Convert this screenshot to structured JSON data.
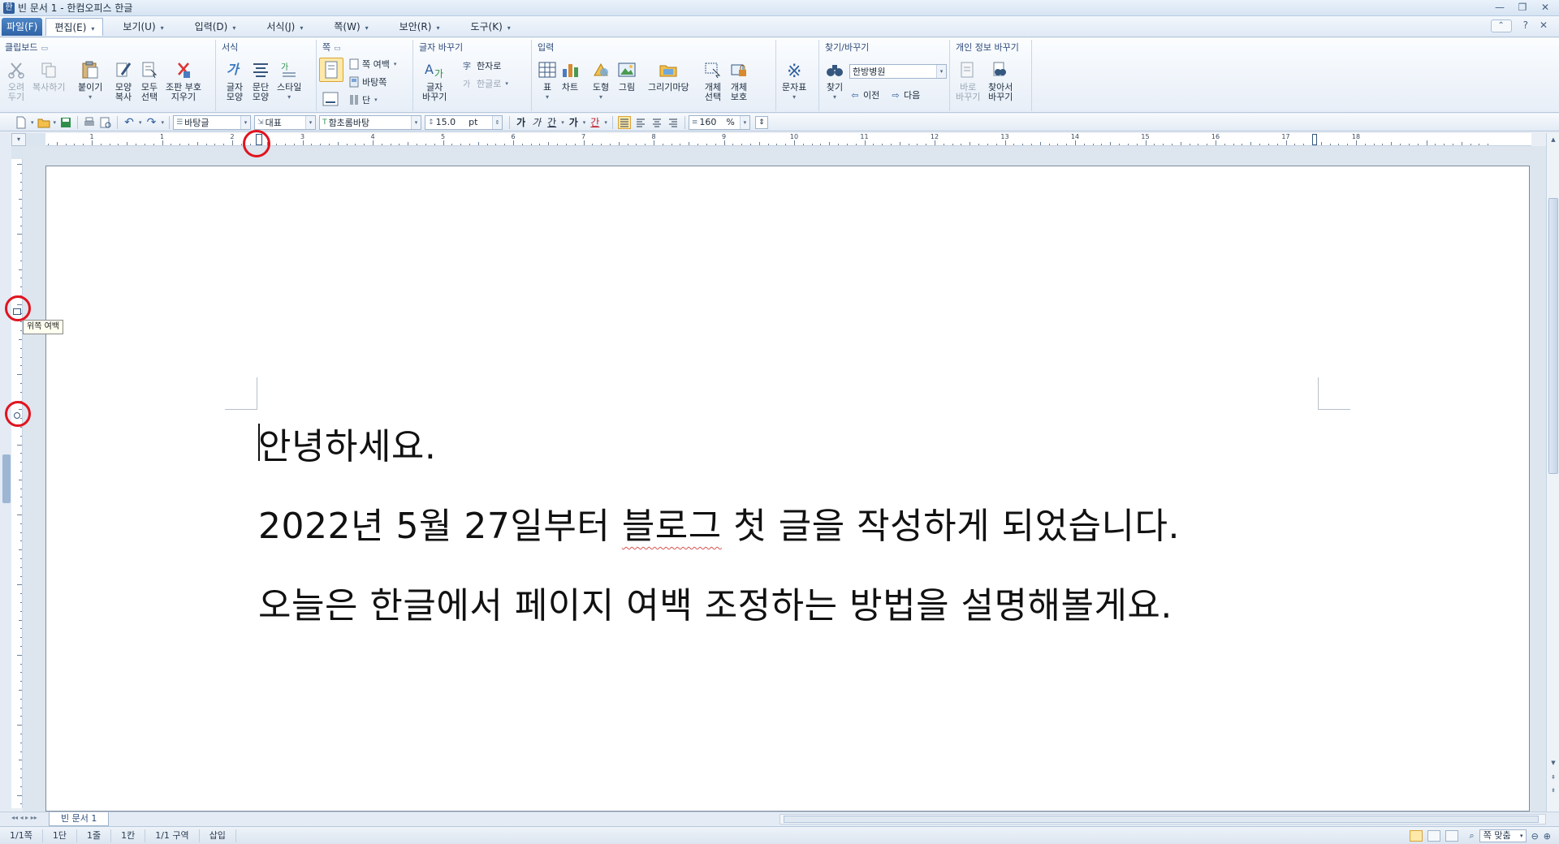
{
  "window": {
    "title": "빈 문서 1 - 한컴오피스 한글",
    "icon_label": "한",
    "minimize_icon": "minimize-icon",
    "restore_icon": "restore-icon",
    "close_icon": "close-icon"
  },
  "menubar": {
    "file": "파일(F)",
    "edit": "편집(E)",
    "view": "보기(U)",
    "insert": "입력(D)",
    "format": "서식(J)",
    "page": "쪽(W)",
    "security": "보안(R)",
    "tools": "도구(K)",
    "help": "?"
  },
  "ribbon": {
    "clipboard": {
      "label": "클립보드",
      "cut": [
        "오려",
        "두기"
      ],
      "copy": "복사하기",
      "paste": "붙이기",
      "format_painter": [
        "모양",
        "복사"
      ],
      "select_all": [
        "모두",
        "선택"
      ],
      "clear_marks": [
        "조판 부호",
        "지우기"
      ]
    },
    "format": {
      "label": "서식",
      "char_shape": [
        "글자",
        "모양"
      ],
      "para_shape": [
        "문단",
        "모양"
      ],
      "style": "스타일"
    },
    "page": {
      "label": "쪽",
      "margin": "쪽 여백",
      "background": "바탕쪽",
      "columns": "단"
    },
    "change_char": {
      "label": "글자 바꾸기",
      "change": [
        "글자",
        "바꾸기"
      ],
      "to_hanja": "한자로",
      "to_hangul": "한글로"
    },
    "input": {
      "label": "입력",
      "table": "표",
      "chart": "차트",
      "shape": "도형",
      "picture": "그림",
      "drawing": "그리기마당",
      "select_obj": [
        "개체",
        "선택"
      ],
      "protect_obj": [
        "개체",
        "보호"
      ],
      "symbols": "문자표"
    },
    "find": {
      "label": "찾기/바꾸기",
      "find": "찾기",
      "search_value": "한방병원",
      "prev": "이전",
      "next": "다음"
    },
    "privacy": {
      "label": "개인 정보 바꾸기",
      "replace_now": [
        "바로",
        "바꾸기"
      ],
      "find_replace": [
        "찾아서",
        "바꾸기"
      ]
    }
  },
  "toolbar": {
    "style": "바탕글",
    "language": "대표",
    "font": "함초롬바탕",
    "size": "15.0",
    "size_unit": "pt",
    "bold": "가",
    "italic": "가",
    "underline": "간",
    "strike": "가",
    "color": "간",
    "line_spacing": "160",
    "line_spacing_unit": "%"
  },
  "ruler": {
    "numbers": [
      "2",
      "1",
      "1",
      "2",
      "3",
      "4",
      "5",
      "6",
      "7",
      "8",
      "9",
      "10",
      "11",
      "12",
      "13",
      "14",
      "15",
      "16",
      "17",
      "18"
    ],
    "corner": "▾"
  },
  "tooltip": "위쪽 여백",
  "document": {
    "lines": [
      "안녕하세요.",
      "2022년 5월 27일부터 블로그 첫 글을 작성하게 되었습니다.",
      "오늘은 한글에서 페이지 여백 조정하는 방법을 설명해볼게요."
    ],
    "line2_before": "2022년 5월 27일부터 ",
    "line2_flagged": "블로그",
    "line2_after": " 첫 글을 작성하게 되었습니다."
  },
  "tabs": {
    "doc_tab": "빈 문서 1"
  },
  "status": {
    "page": "1/1쪽",
    "column": "1단",
    "line": "1줄",
    "col_pos": "1칸",
    "section": "1/1 구역",
    "mode": "삽입",
    "zoom": "쪽 맞춤"
  }
}
